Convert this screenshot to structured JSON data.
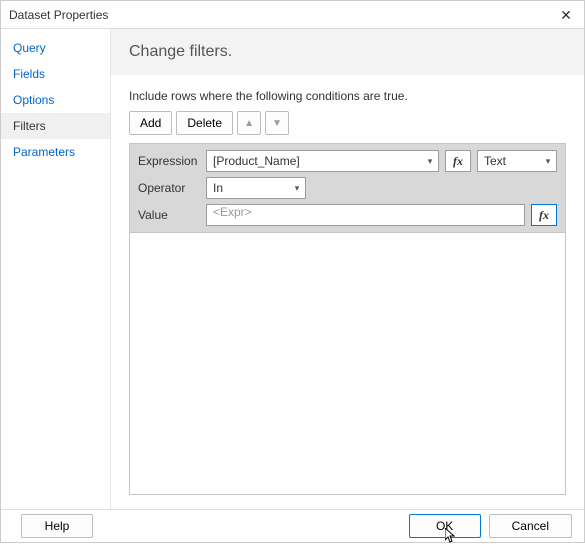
{
  "window": {
    "title": "Dataset Properties",
    "close_glyph": "✕"
  },
  "sidebar": {
    "items": [
      {
        "label": "Query",
        "selected": false
      },
      {
        "label": "Fields",
        "selected": false
      },
      {
        "label": "Options",
        "selected": false
      },
      {
        "label": "Filters",
        "selected": true
      },
      {
        "label": "Parameters",
        "selected": false
      }
    ]
  },
  "content": {
    "header": "Change filters.",
    "instruction": "Include rows where the following conditions are true.",
    "toolbar": {
      "add_label": "Add",
      "delete_label": "Delete",
      "move_up_glyph": "▲",
      "move_down_glyph": "▼"
    },
    "filter": {
      "expression_label": "Expression",
      "expression_value": "[Product_Name]",
      "fx_label": "fx",
      "type_value": "Text",
      "operator_label": "Operator",
      "operator_value": "In",
      "value_label": "Value",
      "value_placeholder": "<Expr>"
    }
  },
  "footer": {
    "help_label": "Help",
    "ok_label": "OK",
    "cancel_label": "Cancel"
  }
}
